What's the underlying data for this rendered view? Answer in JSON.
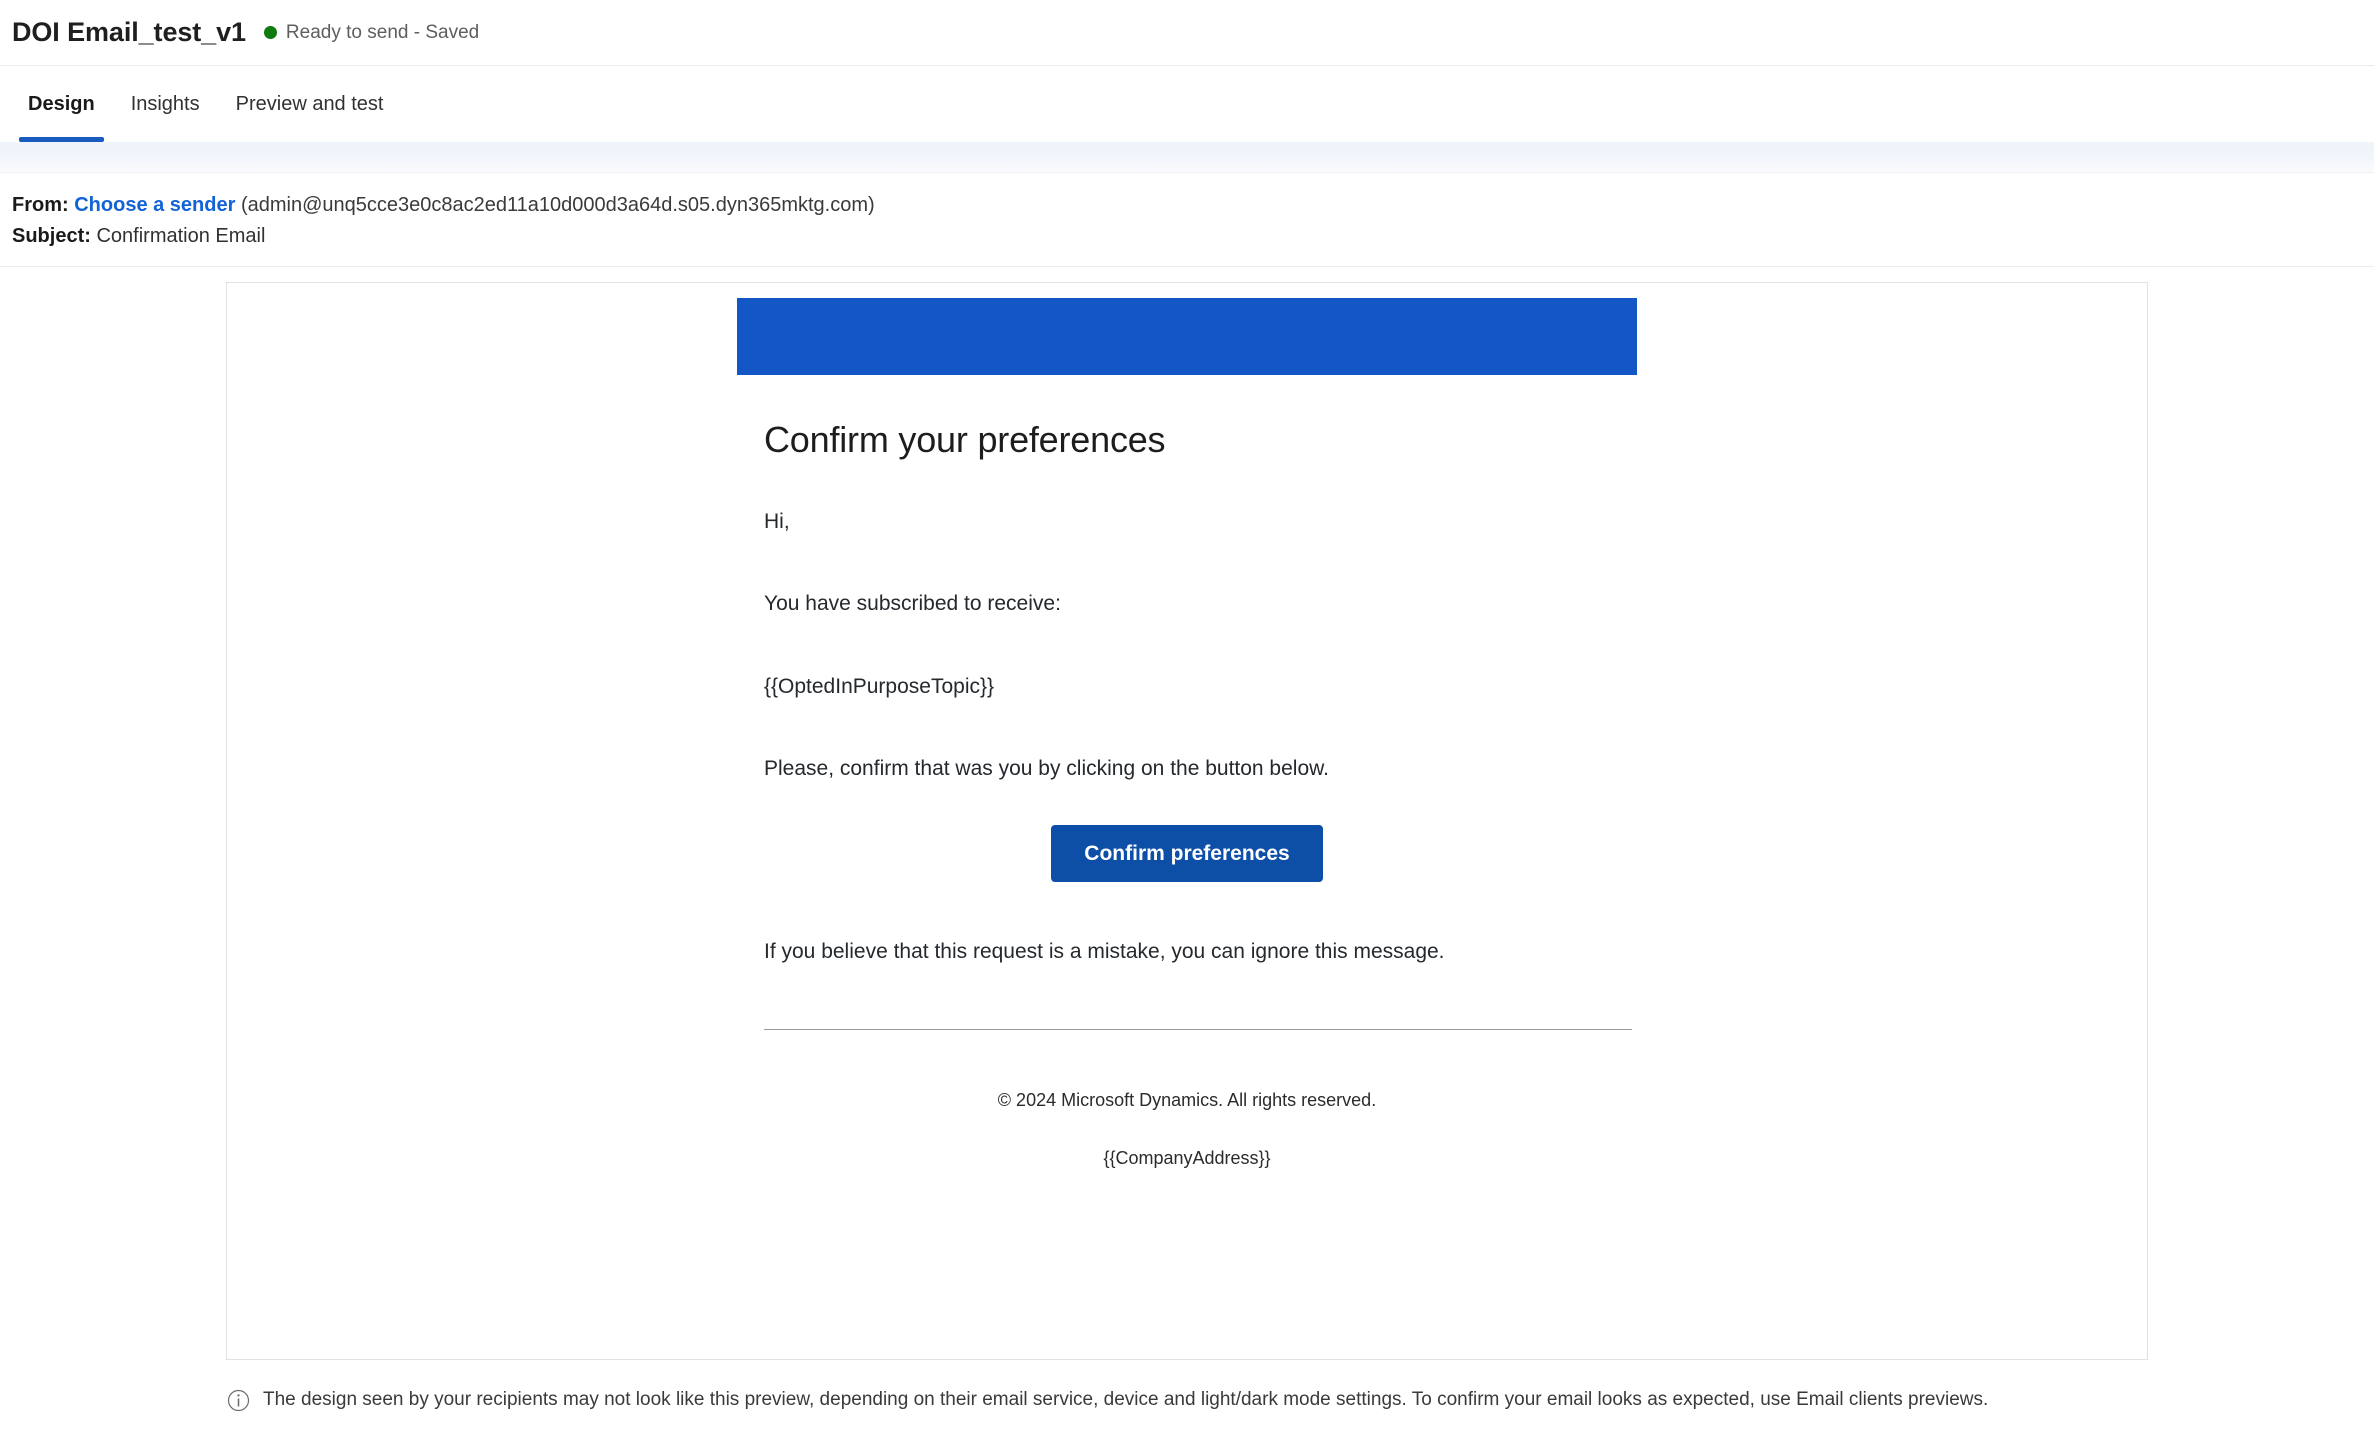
{
  "header": {
    "title": "DOI Email_test_v1",
    "status_text": "Ready to send - Saved",
    "status_dot_color": "#107c10"
  },
  "tabs": [
    {
      "label": "Design",
      "active": true
    },
    {
      "label": "Insights",
      "active": false
    },
    {
      "label": "Preview and test",
      "active": false
    }
  ],
  "meta": {
    "from_label": "From:",
    "sender_link": "Choose a sender",
    "sender_address": "(admin@unq5cce3e0c8ac2ed11a10d000d3a64d.s05.dyn365mktg.com)",
    "subject_label": "Subject:",
    "subject_value": "Confirmation Email"
  },
  "email": {
    "banner_color": "#1356c5",
    "heading": "Confirm your preferences",
    "greeting": "Hi,",
    "subscribed_line": "You have subscribed to receive:",
    "topic_token": "{{OptedInPurposeTopic}}",
    "instruction": "Please, confirm that was you by clicking on the button below.",
    "button_label": "Confirm preferences",
    "button_color": "#0d4ea6",
    "mistake_note": "If you believe that this request is a mistake, you can ignore this message.",
    "footer_copyright": "© 2024 Microsoft Dynamics. All rights reserved.",
    "footer_address_token": "{{CompanyAddress}}"
  },
  "notice": {
    "icon": "info-icon",
    "text": "The design seen by your recipients may not look like this preview, depending on their email service, device and light/dark mode settings. To confirm your email looks as expected, use Email clients previews."
  }
}
